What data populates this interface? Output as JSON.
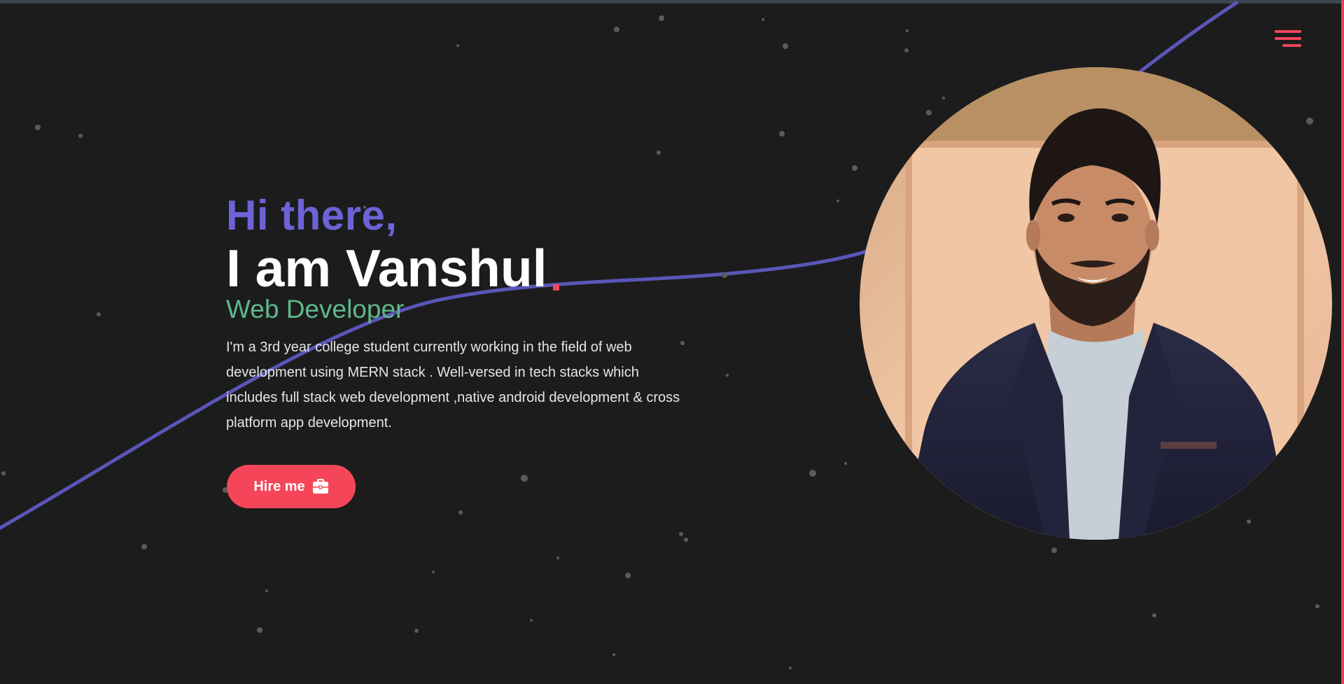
{
  "nav": {
    "menu_icon": "hamburger-menu-icon"
  },
  "hero": {
    "greeting": "Hi there,",
    "name": "I am Vanshul",
    "role": "Web Developer",
    "bio": "I'm a 3rd year college student currently working in the field of web development using MERN stack . Well-versed in tech stacks which includes full stack web development ,native android development & cross platform app development.",
    "hire_label": "Hire me",
    "hire_icon": "briefcase-icon"
  },
  "colors": {
    "background": "#1c1c1d",
    "accent": "#f54659",
    "greeting": "#6d63d7",
    "role": "#5fb88c",
    "curve": "#5a56b8"
  }
}
